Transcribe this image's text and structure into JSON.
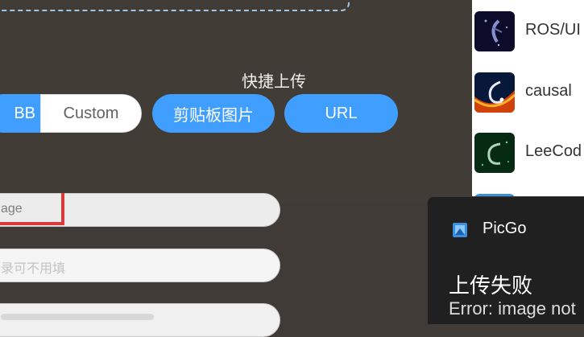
{
  "upload": {
    "quick_title": "快捷上传",
    "segment": {
      "left_label": "BB",
      "right_label": "Custom"
    },
    "buttons": {
      "clipboard": "剪贴板图片",
      "url": "URL"
    }
  },
  "form": {
    "field1_text": "age",
    "field2_placeholder": "录可不用填"
  },
  "gallery": {
    "items": [
      {
        "label": "ROS/UI"
      },
      {
        "label": "causal"
      },
      {
        "label": "LeeCod"
      }
    ]
  },
  "toast": {
    "app_name": "PicGo",
    "title": "上传失败",
    "message": "Error: image not"
  },
  "colors": {
    "accent": "#409eff",
    "panel": "#423c36",
    "error_mark": "#d93a3a",
    "toast_bg": "#202020"
  }
}
